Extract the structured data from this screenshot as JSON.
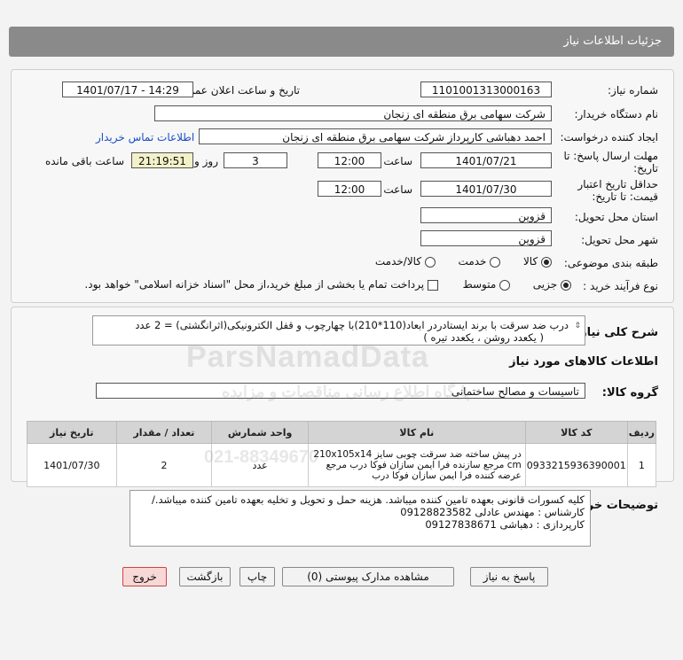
{
  "header": {
    "title": "جزئیات اطلاعات نیاز"
  },
  "form": {
    "need_number_label": "شماره نیاز:",
    "need_number": "1101001313000163",
    "announce_label": "تاریخ و ساعت اعلان عمومی:",
    "announce_value": "1401/07/17 - 14:29",
    "buyer_label": "نام دستگاه خریدار:",
    "buyer_value": "شرکت سهامی برق منطقه ای زنجان",
    "creator_label": "ایجاد کننده درخواست:",
    "creator_value": "احمد دهباشی کارپرداز شرکت سهامی برق منطقه ای زنجان",
    "contact_link": "اطلاعات تماس خریدار",
    "deadline_label_1": "مهلت ارسال پاسخ: تا",
    "deadline_label_2": "تاریخ:",
    "deadline_date": "1401/07/21",
    "time_label": "ساعت",
    "deadline_time": "12:00",
    "days_count": "3",
    "days_label": "روز و",
    "remaining_time": "21:19:51",
    "remaining_label": "ساعت باقی مانده",
    "validity_label_1": "حداقل تاریخ اعتبار",
    "validity_label_2": "قیمت: تا تاریخ:",
    "validity_date": "1401/07/30",
    "validity_time_label": "ساعت",
    "validity_time": "12:00",
    "province_label": "استان محل تحویل:",
    "province_value": "قزوین",
    "city_label": "شهر محل تحویل:",
    "city_value": "قزوین",
    "category_label": "طبقه بندی موضوعی:",
    "category_options": [
      "کالا",
      "خدمت",
      "کالا/خدمت"
    ],
    "process_label": "نوع فرآیند خرید :",
    "process_options": [
      "جزیی",
      "متوسط"
    ],
    "payment_note": "پرداخت تمام یا بخشی از مبلغ خرید،از محل \"اسناد خزانه اسلامی\" خواهد بود."
  },
  "need_desc": {
    "label": "شرح کلی نیاز:",
    "line1": "درب ضد سرقت با برند ایستادردر ابعاد(110*210)با چهارچوب  و قفل الکترونیکی(اثرانگشتی) = 2 عدد",
    "line2": "( یکعدد روشن ، یکعدد تیره )"
  },
  "goods": {
    "section_title": "اطلاعات کالاهای مورد نیاز",
    "group_label": "گروه کالا:",
    "group_value": "تاسیسات و مصالح ساختمانی",
    "columns": [
      "ردیف",
      "کد کالا",
      "نام کالا",
      "واحد شمارش",
      "تعداد / مقدار",
      "تاریخ نیاز"
    ],
    "rows": [
      {
        "row": "1",
        "code": "0933215936390001",
        "name": "در پیش ساخته ضد سرقت چوبی سایز 210x105x14 cm مرجع سازنده فرا ایمن سازان فوکا درب مرجع عرضه کننده فرا ایمن سازان فوکا درب",
        "unit": "عدد",
        "qty": "2",
        "date": "1401/07/30"
      }
    ]
  },
  "buyer_notes": {
    "label": "توضیحات خریدار:",
    "line1": "کلیه کسورات قانونی بعهده تامین  کننده میباشد. هزینه حمل و تحویل  و تخلیه بعهده تامین کننده میباشد./",
    "line2": "کارشناس : مهندس عادلی 09128823582",
    "line3": "کارپردازی : دهباشی 09127838671"
  },
  "buttons": {
    "respond": "پاسخ به نیاز",
    "view_docs": "مشاهده مدارک پیوستی (0)",
    "print": "چاپ",
    "back": "بازگشت",
    "exit": "خروج"
  },
  "watermark": {
    "line1": "ParsNamadData",
    "line2": "پایگاه اطلاع رسانی مناقصات و مزایده",
    "line3": "021-88349670"
  }
}
